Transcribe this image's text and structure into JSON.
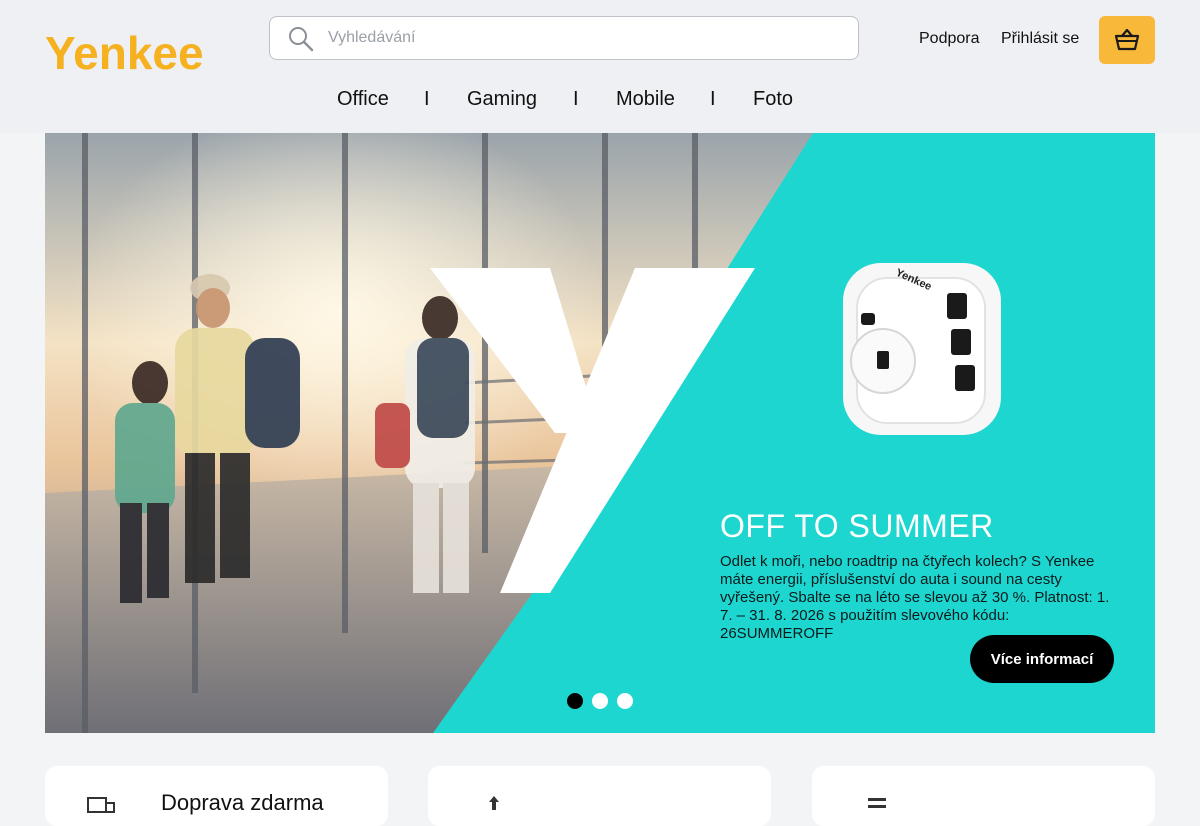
{
  "brand": {
    "name": "Yenkee",
    "accent": "#f5b120",
    "cart_color": "#f8b93a",
    "hero_color": "#1ed6d0"
  },
  "search": {
    "placeholder": "Vyhledávání",
    "value": ""
  },
  "header_links": {
    "support": "Podpora",
    "login": "Přihlásit se"
  },
  "nav": {
    "items": [
      "Office",
      "Gaming",
      "Mobile",
      "Foto"
    ],
    "separator": "I"
  },
  "hero": {
    "title": "OFF TO SUMMER",
    "text": "Odlet k moři, nebo roadtrip na čtyřech kolech? S Yenkee máte energii, příslušenství do auta i sound na cesty vyřešený. Sbalte se na léto se slevou až 30 %. Platnost: 1. 7. – 31. 8. 2026 s použitím slevového kódu: 26SUMMEROFF",
    "button_label": "Více informací",
    "product_label": "Yenkee",
    "slides": 3,
    "active_slide": 1
  },
  "cards": [
    {
      "title": "Doprava zdarma",
      "icon": "delivery-icon"
    },
    {
      "title": "",
      "icon": "upload-icon"
    },
    {
      "title": "",
      "icon": "list-icon"
    }
  ],
  "icons": {
    "search": "search-icon",
    "cart": "basket-icon"
  }
}
